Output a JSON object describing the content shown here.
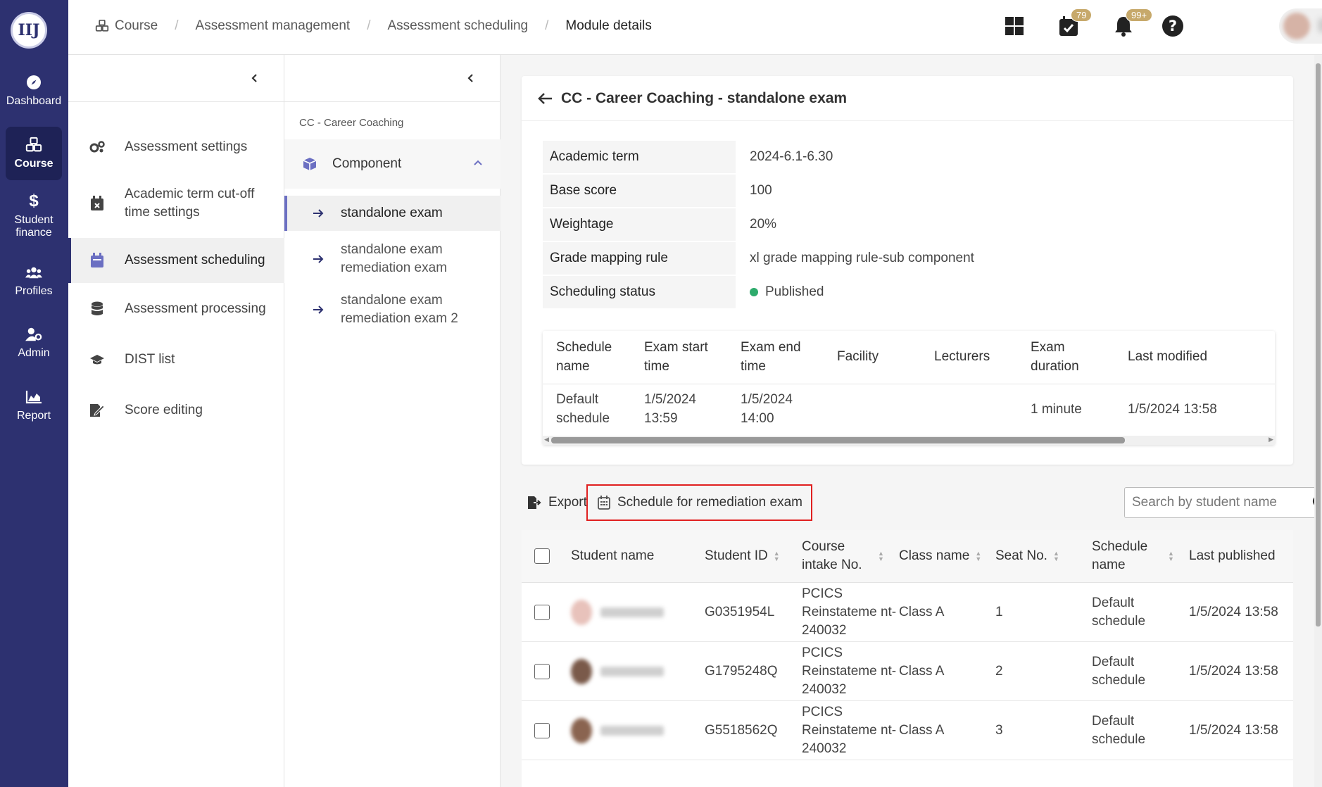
{
  "rail": {
    "logo_text": "IIJ",
    "items": [
      {
        "label": "Dashboard"
      },
      {
        "label": "Course"
      },
      {
        "label": "Student finance"
      },
      {
        "label": "Profiles"
      },
      {
        "label": "Admin"
      },
      {
        "label": "Report"
      }
    ]
  },
  "header": {
    "breadcrumbs": [
      "Course",
      "Assessment management",
      "Assessment scheduling",
      "Module details"
    ],
    "separator": "/",
    "tasks_badge": "79",
    "notif_badge": "99+"
  },
  "submenu": {
    "items": [
      {
        "label": "Assessment settings"
      },
      {
        "label": "Academic term cut-off time settings"
      },
      {
        "label": "Assessment scheduling"
      },
      {
        "label": "Assessment processing"
      },
      {
        "label": "DIST list"
      },
      {
        "label": "Score editing"
      }
    ]
  },
  "module_panel": {
    "title": "CC - Career Coaching",
    "component_label": "Component",
    "items": [
      {
        "label": "standalone exam"
      },
      {
        "label": "standalone exam remediation exam"
      },
      {
        "label": "standalone exam remediation exam 2"
      }
    ]
  },
  "detail": {
    "title": "CC - Career Coaching - standalone exam",
    "fields": [
      {
        "key": "Academic term",
        "value": "2024-6.1-6.30"
      },
      {
        "key": "Base score",
        "value": "100"
      },
      {
        "key": "Weightage",
        "value": "20%"
      },
      {
        "key": "Grade mapping rule",
        "value": "xl grade mapping rule-sub component"
      },
      {
        "key": "Scheduling status",
        "value": "Published"
      }
    ],
    "status_color": "#2eab6c"
  },
  "schedule_table": {
    "headers": [
      "Schedule name",
      "Exam start time",
      "Exam end time",
      "Facility",
      "Lecturers",
      "Exam duration",
      "Last modified"
    ],
    "rows": [
      [
        "Default schedule",
        "1/5/2024 13:59",
        "1/5/2024 14:00",
        "",
        "",
        "1 minute",
        "1/5/2024 13:58"
      ]
    ]
  },
  "toolbar": {
    "export_label": "Export",
    "remediation_label": "Schedule for remediation exam",
    "search_placeholder": "Search by student name"
  },
  "student_table": {
    "headers": [
      "Student name",
      "Student ID",
      "Course intake No.",
      "Class name",
      "Seat No.",
      "Schedule name",
      "Last published"
    ],
    "rows": [
      {
        "student_id": "G0351954L",
        "course_intake": "PCICS Reinstateme nt-240032",
        "class_name": "Class A",
        "seat": "1",
        "schedule": "Default schedule",
        "last_published": "1/5/2024 13:58"
      },
      {
        "student_id": "G1795248Q",
        "course_intake": "PCICS Reinstateme nt-240032",
        "class_name": "Class A",
        "seat": "2",
        "schedule": "Default schedule",
        "last_published": "1/5/2024 13:58"
      },
      {
        "student_id": "G5518562Q",
        "course_intake": "PCICS Reinstateme nt-240032",
        "class_name": "Class A",
        "seat": "3",
        "schedule": "Default schedule",
        "last_published": "1/5/2024 13:58"
      }
    ]
  },
  "colors": {
    "rail_bg": "#2d3170",
    "highlight_border": "#e02020",
    "badge": "#c7a96b"
  }
}
